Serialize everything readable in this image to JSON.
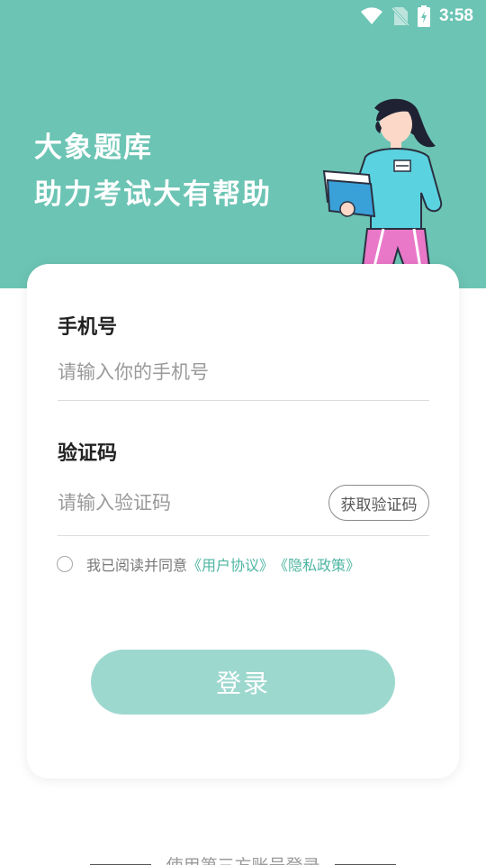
{
  "status_bar": {
    "time": "3:58",
    "icons": [
      "wifi-icon",
      "no-sim-icon",
      "battery-charging-icon"
    ]
  },
  "header": {
    "slogan_line1": "大象题库",
    "slogan_line2": "助力考试大有帮助",
    "background_color": "#6cc4b4"
  },
  "login_form": {
    "phone": {
      "label": "手机号",
      "placeholder": "请输入你的手机号",
      "value": ""
    },
    "code": {
      "label": "验证码",
      "placeholder": "请输入验证码",
      "value": "",
      "get_code_button": "获取验证码"
    },
    "agreement": {
      "checked": false,
      "text": "我已阅读并同意",
      "user_agreement_link": "《用户协议》",
      "privacy_policy_link": "《隐私政策》"
    },
    "login_button": "登录"
  },
  "footer": {
    "third_party_text": "使用第三方账号登录"
  },
  "colors": {
    "accent": "#4eb5a2",
    "login_button": "#9dd8cf"
  }
}
